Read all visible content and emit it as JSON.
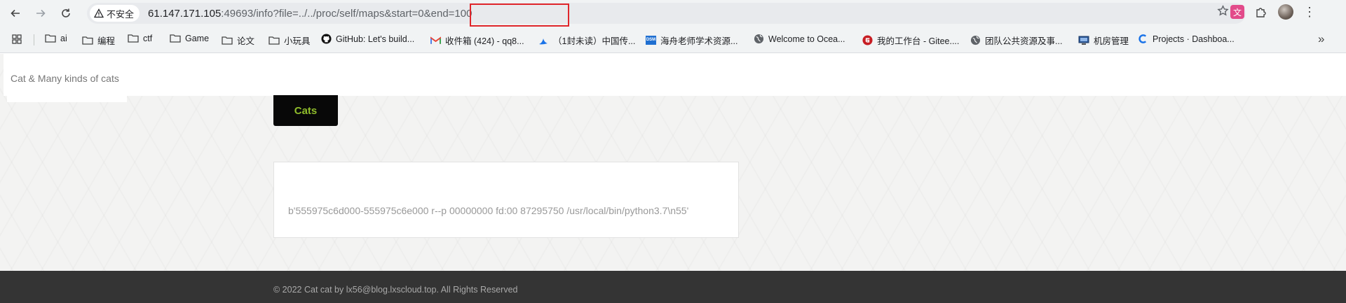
{
  "browser": {
    "security_label": "不安全",
    "url_host": "61.147.171.105",
    "url_rest": ":49693/info?file=../../proc/self/maps&start=0&end=100",
    "bookmarks": [
      {
        "label": "",
        "icon": "apps-grid-icon"
      },
      {
        "label": "ai",
        "icon": "folder-icon"
      },
      {
        "label": "编程",
        "icon": "folder-icon"
      },
      {
        "label": "ctf",
        "icon": "folder-icon"
      },
      {
        "label": "Game",
        "icon": "folder-icon"
      },
      {
        "label": "论文",
        "icon": "folder-icon"
      },
      {
        "label": "小玩具",
        "icon": "folder-icon"
      },
      {
        "label": "GitHub: Let's build...",
        "icon": "github-icon"
      },
      {
        "label": "收件箱 (424) - qq8...",
        "icon": "gmail-icon"
      },
      {
        "label": "（1封未读）中国传...",
        "icon": "mail-bird-icon"
      },
      {
        "label": "海舟老师学术资源...",
        "icon": "dsm-icon"
      },
      {
        "label": "Welcome to Ocea...",
        "icon": "globe-icon"
      },
      {
        "label": "我的工作台 - Gitee....",
        "icon": "gitee-icon"
      },
      {
        "label": "团队公共资源及事...",
        "icon": "globe-icon"
      },
      {
        "label": "机房管理",
        "icon": "monitor-icon"
      },
      {
        "label": "Projects · Dashboa...",
        "icon": "projects-icon"
      }
    ],
    "overflow_label": "»"
  },
  "site": {
    "title": "Cat & Many kinds of cats",
    "nav_button": "Cats",
    "content": "b'555975c6d000-555975c6e000 r--p 00000000 fd:00 87295750 /usr/local/bin/python3.7\\n55'",
    "footer": "© 2022 Cat cat by lx56@blog.lxscloud.top. All Rights Reserved"
  },
  "colors": {
    "accent_green": "#8fbc2b",
    "highlight_red": "#e0262b",
    "footer_bg": "#343434"
  }
}
